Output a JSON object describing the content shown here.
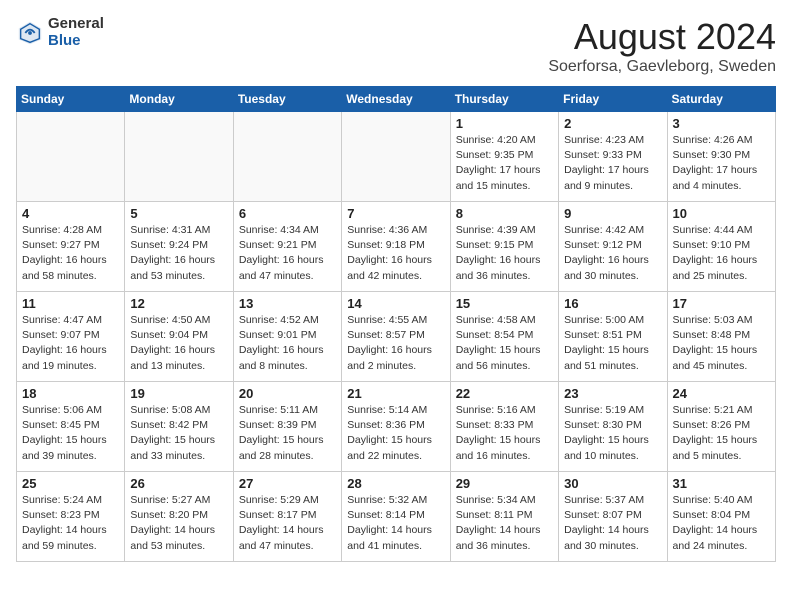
{
  "logo": {
    "general": "General",
    "blue": "Blue"
  },
  "title": "August 2024",
  "location": "Soerforsa, Gaevleborg, Sweden",
  "days_of_week": [
    "Sunday",
    "Monday",
    "Tuesday",
    "Wednesday",
    "Thursday",
    "Friday",
    "Saturday"
  ],
  "weeks": [
    [
      {
        "day": "",
        "info": ""
      },
      {
        "day": "",
        "info": ""
      },
      {
        "day": "",
        "info": ""
      },
      {
        "day": "",
        "info": ""
      },
      {
        "day": "1",
        "info": "Sunrise: 4:20 AM\nSunset: 9:35 PM\nDaylight: 17 hours\nand 15 minutes."
      },
      {
        "day": "2",
        "info": "Sunrise: 4:23 AM\nSunset: 9:33 PM\nDaylight: 17 hours\nand 9 minutes."
      },
      {
        "day": "3",
        "info": "Sunrise: 4:26 AM\nSunset: 9:30 PM\nDaylight: 17 hours\nand 4 minutes."
      }
    ],
    [
      {
        "day": "4",
        "info": "Sunrise: 4:28 AM\nSunset: 9:27 PM\nDaylight: 16 hours\nand 58 minutes."
      },
      {
        "day": "5",
        "info": "Sunrise: 4:31 AM\nSunset: 9:24 PM\nDaylight: 16 hours\nand 53 minutes."
      },
      {
        "day": "6",
        "info": "Sunrise: 4:34 AM\nSunset: 9:21 PM\nDaylight: 16 hours\nand 47 minutes."
      },
      {
        "day": "7",
        "info": "Sunrise: 4:36 AM\nSunset: 9:18 PM\nDaylight: 16 hours\nand 42 minutes."
      },
      {
        "day": "8",
        "info": "Sunrise: 4:39 AM\nSunset: 9:15 PM\nDaylight: 16 hours\nand 36 minutes."
      },
      {
        "day": "9",
        "info": "Sunrise: 4:42 AM\nSunset: 9:12 PM\nDaylight: 16 hours\nand 30 minutes."
      },
      {
        "day": "10",
        "info": "Sunrise: 4:44 AM\nSunset: 9:10 PM\nDaylight: 16 hours\nand 25 minutes."
      }
    ],
    [
      {
        "day": "11",
        "info": "Sunrise: 4:47 AM\nSunset: 9:07 PM\nDaylight: 16 hours\nand 19 minutes."
      },
      {
        "day": "12",
        "info": "Sunrise: 4:50 AM\nSunset: 9:04 PM\nDaylight: 16 hours\nand 13 minutes."
      },
      {
        "day": "13",
        "info": "Sunrise: 4:52 AM\nSunset: 9:01 PM\nDaylight: 16 hours\nand 8 minutes."
      },
      {
        "day": "14",
        "info": "Sunrise: 4:55 AM\nSunset: 8:57 PM\nDaylight: 16 hours\nand 2 minutes."
      },
      {
        "day": "15",
        "info": "Sunrise: 4:58 AM\nSunset: 8:54 PM\nDaylight: 15 hours\nand 56 minutes."
      },
      {
        "day": "16",
        "info": "Sunrise: 5:00 AM\nSunset: 8:51 PM\nDaylight: 15 hours\nand 51 minutes."
      },
      {
        "day": "17",
        "info": "Sunrise: 5:03 AM\nSunset: 8:48 PM\nDaylight: 15 hours\nand 45 minutes."
      }
    ],
    [
      {
        "day": "18",
        "info": "Sunrise: 5:06 AM\nSunset: 8:45 PM\nDaylight: 15 hours\nand 39 minutes."
      },
      {
        "day": "19",
        "info": "Sunrise: 5:08 AM\nSunset: 8:42 PM\nDaylight: 15 hours\nand 33 minutes."
      },
      {
        "day": "20",
        "info": "Sunrise: 5:11 AM\nSunset: 8:39 PM\nDaylight: 15 hours\nand 28 minutes."
      },
      {
        "day": "21",
        "info": "Sunrise: 5:14 AM\nSunset: 8:36 PM\nDaylight: 15 hours\nand 22 minutes."
      },
      {
        "day": "22",
        "info": "Sunrise: 5:16 AM\nSunset: 8:33 PM\nDaylight: 15 hours\nand 16 minutes."
      },
      {
        "day": "23",
        "info": "Sunrise: 5:19 AM\nSunset: 8:30 PM\nDaylight: 15 hours\nand 10 minutes."
      },
      {
        "day": "24",
        "info": "Sunrise: 5:21 AM\nSunset: 8:26 PM\nDaylight: 15 hours\nand 5 minutes."
      }
    ],
    [
      {
        "day": "25",
        "info": "Sunrise: 5:24 AM\nSunset: 8:23 PM\nDaylight: 14 hours\nand 59 minutes."
      },
      {
        "day": "26",
        "info": "Sunrise: 5:27 AM\nSunset: 8:20 PM\nDaylight: 14 hours\nand 53 minutes."
      },
      {
        "day": "27",
        "info": "Sunrise: 5:29 AM\nSunset: 8:17 PM\nDaylight: 14 hours\nand 47 minutes."
      },
      {
        "day": "28",
        "info": "Sunrise: 5:32 AM\nSunset: 8:14 PM\nDaylight: 14 hours\nand 41 minutes."
      },
      {
        "day": "29",
        "info": "Sunrise: 5:34 AM\nSunset: 8:11 PM\nDaylight: 14 hours\nand 36 minutes."
      },
      {
        "day": "30",
        "info": "Sunrise: 5:37 AM\nSunset: 8:07 PM\nDaylight: 14 hours\nand 30 minutes."
      },
      {
        "day": "31",
        "info": "Sunrise: 5:40 AM\nSunset: 8:04 PM\nDaylight: 14 hours\nand 24 minutes."
      }
    ]
  ]
}
